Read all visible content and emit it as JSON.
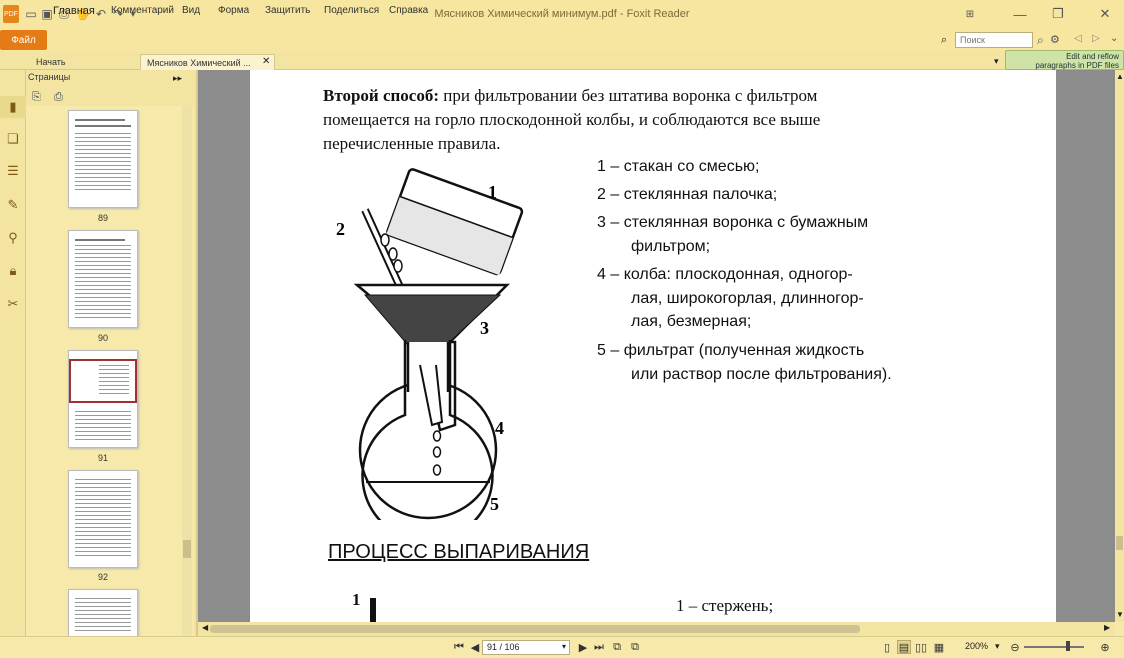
{
  "window": {
    "title": "Мясников Химический минимум.pdf - Foxit Reader"
  },
  "ribbon": {
    "file": "Файл",
    "menus": [
      "Главная",
      "Комментарий",
      "Вид",
      "Форма",
      "Защитить",
      "Поделиться",
      "Справка"
    ],
    "search_placeholder": "Поиск"
  },
  "tabs": {
    "start": "Начать",
    "document": "Мясников Химический ...",
    "reflow": "Edit and reflow\nparagraphs in PDF files"
  },
  "panel": {
    "title": "Страницы",
    "thumbnails": [
      "89",
      "90",
      "91",
      "92"
    ]
  },
  "document": {
    "para_bold": "Второй способ:",
    "para_line1": " при фильтровании без штатива воронка с фильтром",
    "para_line2": "помещается на горло плоскодонной колбы, и соблюдаются все выше",
    "para_line3": "перечисленные правила.",
    "figure_labels": [
      "1",
      "2",
      "3",
      "4",
      "5"
    ],
    "legend": [
      "1 –  стакан со смесью;",
      "2 –  стеклянная палочка;",
      "3 –   стеклянная воронка с бумажным",
      "фильтром;",
      "4 –  колба: плоскодонная, одногор-",
      "лая, широкогорлая, длинногор-",
      "лая, безмерная;",
      "5 –  фильтрат (полученная жидкость",
      "или раствор после фильтрования)."
    ],
    "section_title": "ПРОЦЕСС ВЫПАРИВАНИЯ",
    "fig2_label": "1",
    "fig2_legend": "1 – стержень;"
  },
  "status": {
    "page": "91 / 106",
    "zoom": "200%"
  }
}
